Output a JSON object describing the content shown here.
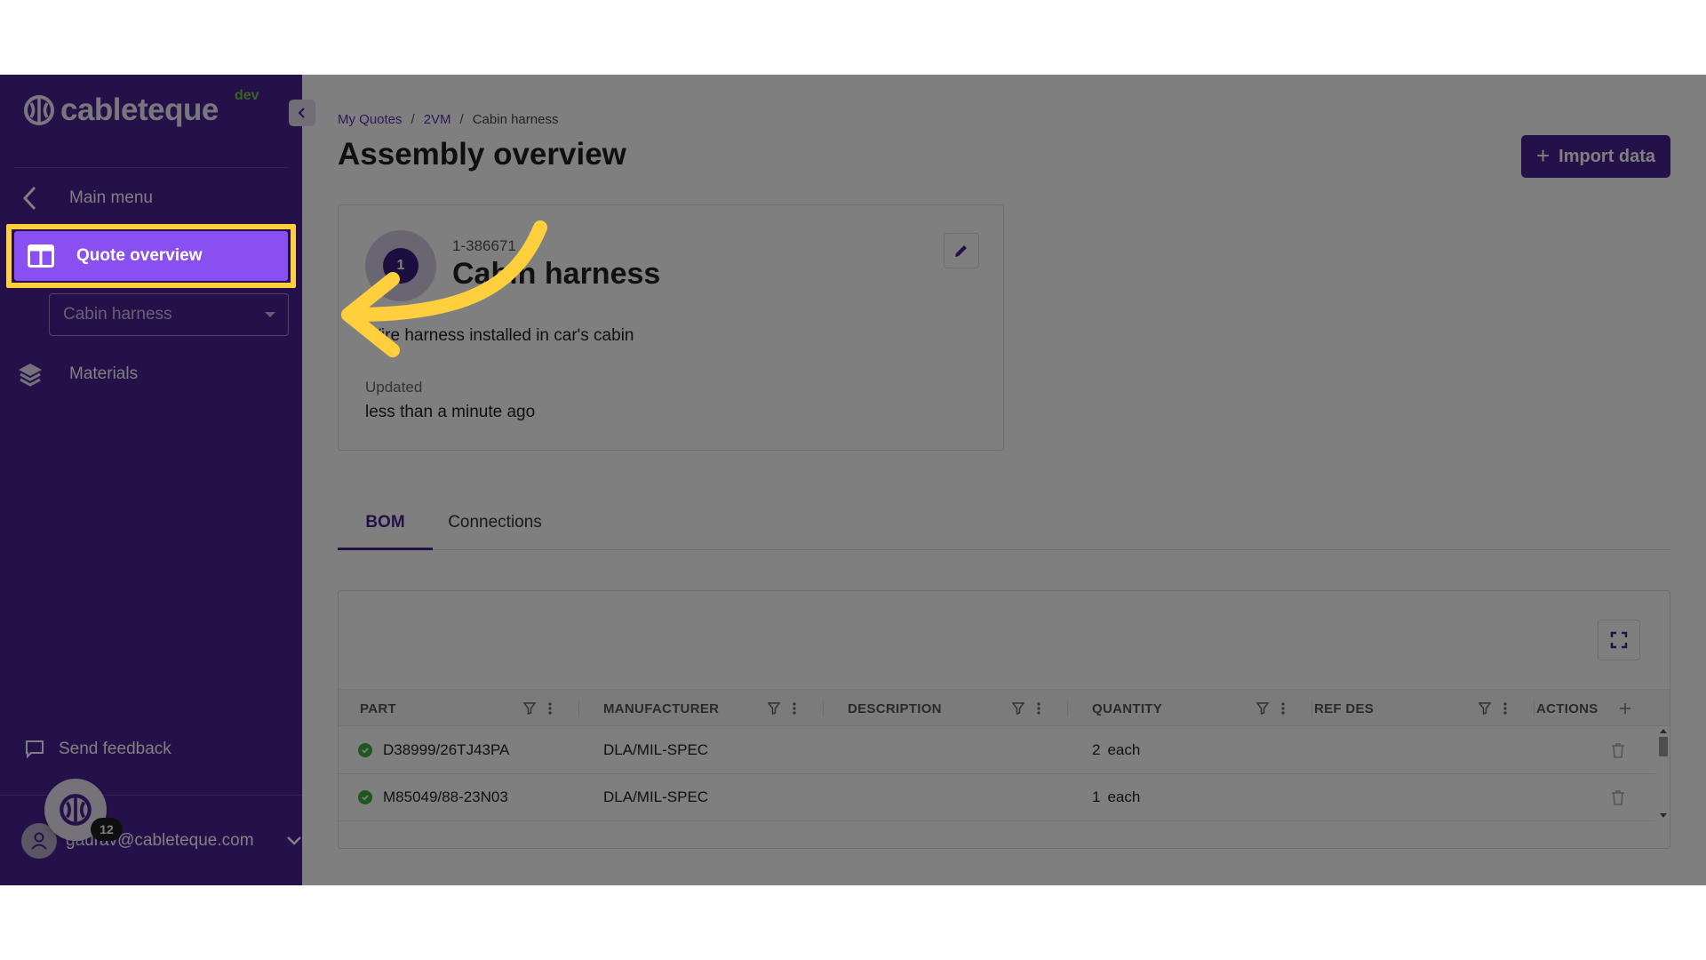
{
  "sidebar": {
    "brand": "cableteque",
    "environment": "dev",
    "nav": {
      "main_menu": "Main menu",
      "quote_overview": "Quote overview",
      "materials": "Materials"
    },
    "assembly_select_value": "Cabin harness",
    "send_feedback": "Send feedback",
    "user_email": "gaurav@cableteque.com",
    "help_badge_count": "12"
  },
  "breadcrumb": [
    "My Quotes",
    "2VM",
    "Cabin harness"
  ],
  "page_title": "Assembly overview",
  "import_button": {
    "plus": "+",
    "label": "Import data"
  },
  "assembly_card": {
    "status_icon": "1",
    "assembly_id": "1-386671",
    "name": "Cabin harness",
    "description": "Wire harness installed in car's cabin",
    "updated_label": "Updated",
    "updated_value": "less than a minute ago"
  },
  "tabs": [
    "BOM",
    "Connections"
  ],
  "bom_table": {
    "columns": [
      "PART",
      "MANUFACTURER",
      "DESCRIPTION",
      "QUANTITY",
      "REF DES",
      "ACTIONS"
    ],
    "rows": [
      {
        "part": "D38999/26TJ43PA",
        "manufacturer": "DLA/MIL-SPEC",
        "description": "",
        "quantity": "2",
        "unit": "each",
        "ref_des": ""
      },
      {
        "part": "M85049/88-23N03",
        "manufacturer": "DLA/MIL-SPEC",
        "description": "",
        "quantity": "1",
        "unit": "each",
        "ref_des": ""
      }
    ]
  },
  "colors": {
    "sidebar_bg": "#4a2395",
    "active_nav": "#8a4ff0",
    "highlight": "#ffcf3e",
    "primary": "#4a2395",
    "valid": "#3fae3f"
  }
}
